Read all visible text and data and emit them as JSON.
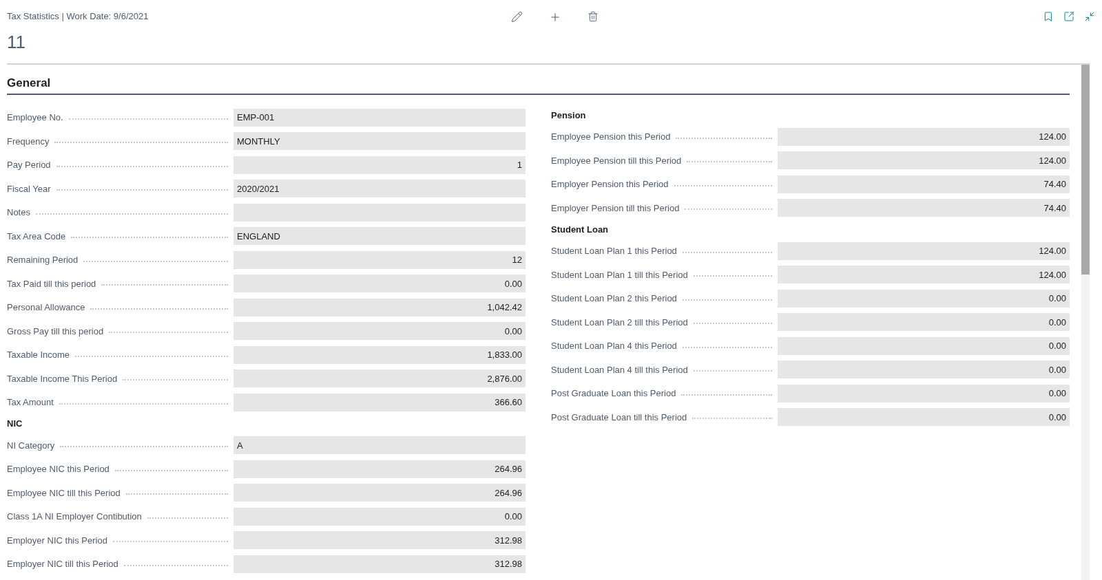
{
  "header": {
    "caption": "Tax Statistics | Work Date: 9/6/2021",
    "record": "11"
  },
  "section": {
    "title": "General"
  },
  "left_groups": [
    {
      "fields": [
        {
          "label": "Employee No.",
          "value": "EMP-001",
          "kind": "text"
        },
        {
          "label": "Frequency",
          "value": "MONTHLY",
          "kind": "text"
        },
        {
          "label": "Pay Period",
          "value": "1",
          "kind": "number"
        },
        {
          "label": "Fiscal Year",
          "value": "2020/2021",
          "kind": "text"
        },
        {
          "label": "Notes",
          "kind": "text"
        },
        {
          "label": "Tax Area Code",
          "value": "ENGLAND",
          "kind": "text"
        },
        {
          "label": "Remaining Period",
          "value": "12",
          "kind": "number"
        },
        {
          "label": "Tax Paid till this period",
          "value": "0.00",
          "kind": "number"
        },
        {
          "label": "Personal Allowance",
          "value": "1,042.42",
          "kind": "number"
        },
        {
          "label": "Gross Pay till this period",
          "value": "0.00",
          "kind": "number"
        },
        {
          "label": "Taxable Income",
          "value": "1,833.00",
          "kind": "number"
        },
        {
          "label": "Taxable Income This Period",
          "value": "2,876.00",
          "kind": "number"
        },
        {
          "label": "Tax Amount",
          "value": "366.60",
          "kind": "number"
        }
      ]
    },
    {
      "title": "NIC",
      "fields": [
        {
          "label": "NI Category",
          "value": "A",
          "kind": "text"
        },
        {
          "label": "Employee NIC this Period",
          "value": "264.96",
          "kind": "number"
        },
        {
          "label": "Employee NIC till this Period",
          "value": "264.96",
          "kind": "number"
        },
        {
          "label": "Class 1A NI Employer Contibution",
          "value": "0.00",
          "kind": "number"
        },
        {
          "label": "Employer NIC this Period",
          "value": "312.98",
          "kind": "number"
        },
        {
          "label": "Employer NIC till this Period",
          "value": "312.98",
          "kind": "number"
        }
      ]
    }
  ],
  "right_groups": [
    {
      "title": "Pension",
      "fields": [
        {
          "label": "Employee Pension this Period",
          "value": "124.00",
          "kind": "number"
        },
        {
          "label": "Employee Pension till this Period",
          "value": "124.00",
          "kind": "number"
        },
        {
          "label": "Employer Pension this Period",
          "value": "74.40",
          "kind": "number"
        },
        {
          "label": "Employer Pension till this Period",
          "value": "74.40",
          "kind": "number"
        }
      ]
    },
    {
      "title": "Student Loan",
      "fields": [
        {
          "label": "Student Loan Plan 1 this Period",
          "value": "124.00",
          "kind": "number"
        },
        {
          "label": "Student Loan Plan 1 till this Period",
          "value": "124.00",
          "kind": "number"
        },
        {
          "label": "Student Loan Plan 2 this Period",
          "value": "0.00",
          "kind": "number"
        },
        {
          "label": "Student Loan Plan 2 till this Period",
          "value": "0.00",
          "kind": "number"
        },
        {
          "label": "Student Loan Plan 4 this Period",
          "value": "0.00",
          "kind": "number"
        },
        {
          "label": "Student Loan Plan 4 till this Period",
          "value": "0.00",
          "kind": "number"
        },
        {
          "label": "Post Graduate Loan this Period",
          "value": "0.00",
          "kind": "number"
        },
        {
          "label": "Post Graduate Loan till this Period",
          "value": "0.00",
          "kind": "number"
        }
      ]
    }
  ]
}
